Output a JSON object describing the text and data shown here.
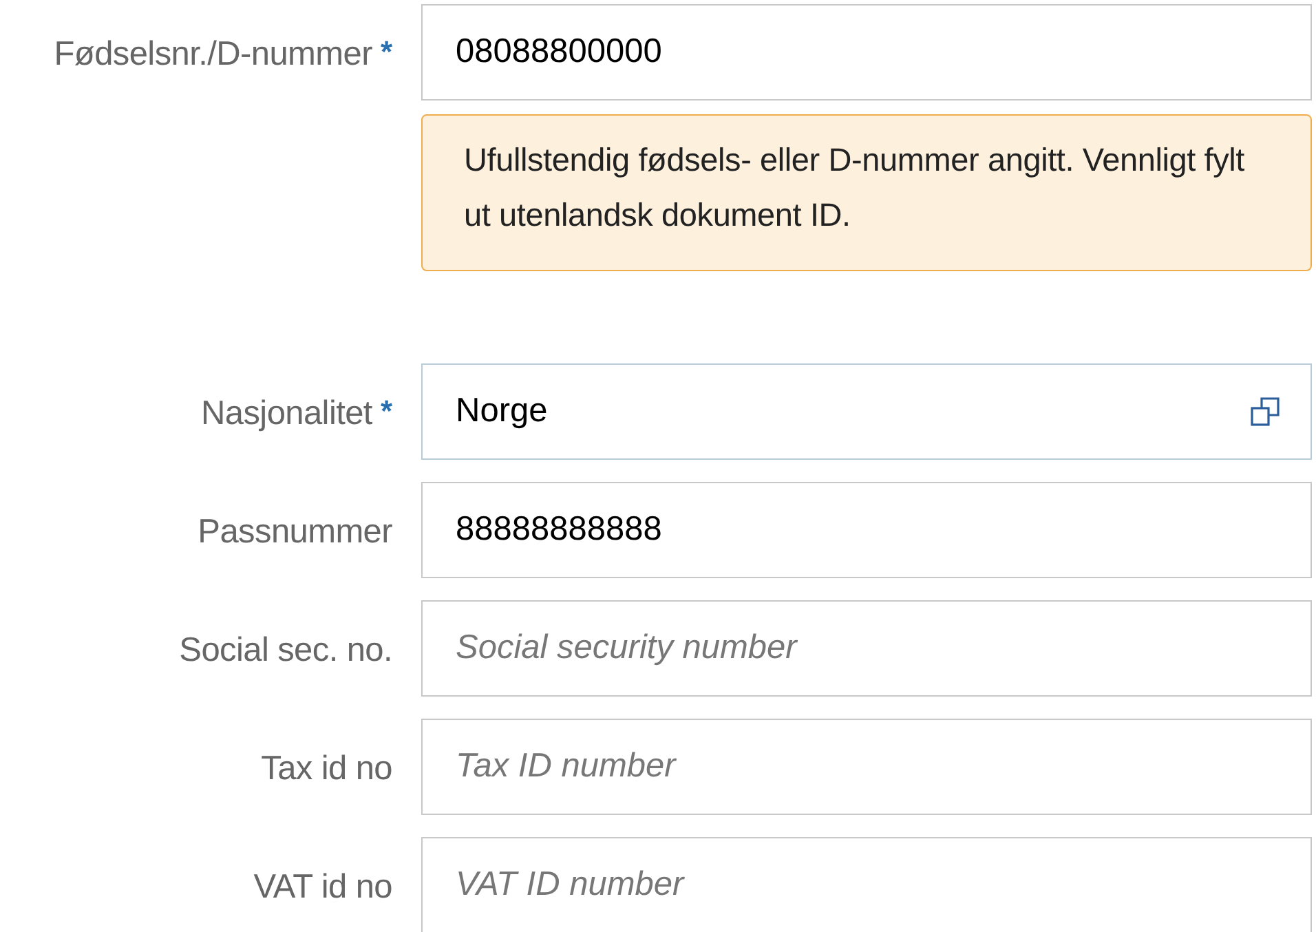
{
  "fields": [
    {
      "kind": "text",
      "label": "Fødselsnr./D-nummer",
      "required_mark": "*",
      "value": "08088800000",
      "warning": "Ufullstendig fødsels- eller D-nummer angitt. Vennligt fylt ut utenlandsk dokument ID."
    },
    {
      "kind": "select",
      "label": "Nasjonalitet",
      "required_mark": "*",
      "value": "Norge"
    },
    {
      "kind": "text",
      "label": "Passnummer",
      "value": "88888888888"
    },
    {
      "kind": "text",
      "label": "Social sec. no.",
      "placeholder": "Social security number"
    },
    {
      "kind": "text",
      "label": "Tax id no",
      "placeholder": "Tax ID number"
    },
    {
      "kind": "text",
      "label": "VAT id no",
      "placeholder": "VAT ID number"
    }
  ]
}
